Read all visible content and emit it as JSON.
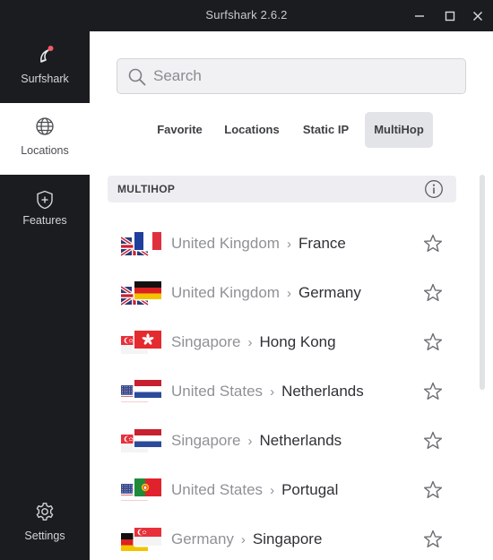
{
  "window": {
    "title": "Surfshark 2.6.2"
  },
  "sidebar": {
    "items": [
      {
        "label": "Surfshark",
        "icon": "surfshark-logo-icon"
      },
      {
        "label": "Locations",
        "icon": "globe-icon",
        "active": true
      },
      {
        "label": "Features",
        "icon": "shield-plus-icon"
      },
      {
        "label": "Settings",
        "icon": "gear-icon"
      }
    ]
  },
  "search": {
    "placeholder": "Search",
    "value": ""
  },
  "tabs": [
    {
      "label": "Favorite"
    },
    {
      "label": "Locations"
    },
    {
      "label": "Static IP"
    },
    {
      "label": "MultiHop",
      "active": true
    }
  ],
  "section": {
    "title": "MULTIHOP",
    "info_icon": "info-icon"
  },
  "rows": [
    {
      "from": "United Kingdom",
      "to": "France",
      "from_flag": "gb",
      "to_flag": "fr"
    },
    {
      "from": "United Kingdom",
      "to": "Germany",
      "from_flag": "gb",
      "to_flag": "de"
    },
    {
      "from": "Singapore",
      "to": "Hong Kong",
      "from_flag": "sg",
      "to_flag": "hk"
    },
    {
      "from": "United States",
      "to": "Netherlands",
      "from_flag": "us",
      "to_flag": "nl"
    },
    {
      "from": "Singapore",
      "to": "Netherlands",
      "from_flag": "sg",
      "to_flag": "nl"
    },
    {
      "from": "United States",
      "to": "Portugal",
      "from_flag": "us",
      "to_flag": "pt"
    },
    {
      "from": "Germany",
      "to": "Singapore",
      "from_flag": "de",
      "to_flag": "sg"
    }
  ],
  "colors": {
    "sidebar_bg": "#1b1c1f",
    "accent_logo_dot": "#f25a6a",
    "active_tab_bg": "#e3e4e8"
  }
}
